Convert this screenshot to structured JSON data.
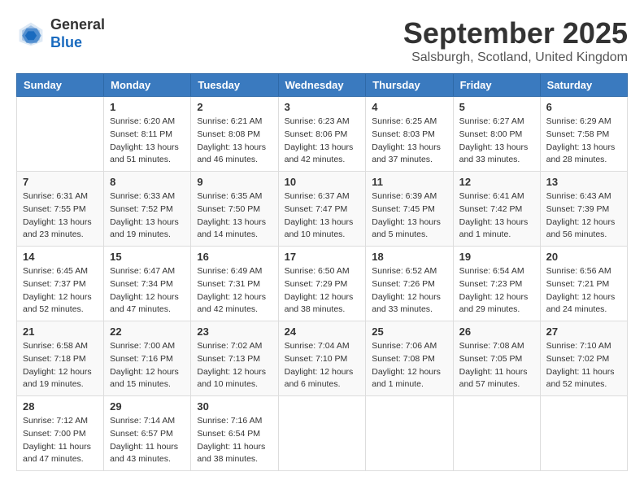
{
  "logo": {
    "general": "General",
    "blue": "Blue"
  },
  "header": {
    "month": "September 2025",
    "location": "Salsburgh, Scotland, United Kingdom"
  },
  "weekdays": [
    "Sunday",
    "Monday",
    "Tuesday",
    "Wednesday",
    "Thursday",
    "Friday",
    "Saturday"
  ],
  "weeks": [
    [
      {
        "day": "",
        "sunrise": "",
        "sunset": "",
        "daylight": ""
      },
      {
        "day": "1",
        "sunrise": "Sunrise: 6:20 AM",
        "sunset": "Sunset: 8:11 PM",
        "daylight": "Daylight: 13 hours and 51 minutes."
      },
      {
        "day": "2",
        "sunrise": "Sunrise: 6:21 AM",
        "sunset": "Sunset: 8:08 PM",
        "daylight": "Daylight: 13 hours and 46 minutes."
      },
      {
        "day": "3",
        "sunrise": "Sunrise: 6:23 AM",
        "sunset": "Sunset: 8:06 PM",
        "daylight": "Daylight: 13 hours and 42 minutes."
      },
      {
        "day": "4",
        "sunrise": "Sunrise: 6:25 AM",
        "sunset": "Sunset: 8:03 PM",
        "daylight": "Daylight: 13 hours and 37 minutes."
      },
      {
        "day": "5",
        "sunrise": "Sunrise: 6:27 AM",
        "sunset": "Sunset: 8:00 PM",
        "daylight": "Daylight: 13 hours and 33 minutes."
      },
      {
        "day": "6",
        "sunrise": "Sunrise: 6:29 AM",
        "sunset": "Sunset: 7:58 PM",
        "daylight": "Daylight: 13 hours and 28 minutes."
      }
    ],
    [
      {
        "day": "7",
        "sunrise": "Sunrise: 6:31 AM",
        "sunset": "Sunset: 7:55 PM",
        "daylight": "Daylight: 13 hours and 23 minutes."
      },
      {
        "day": "8",
        "sunrise": "Sunrise: 6:33 AM",
        "sunset": "Sunset: 7:52 PM",
        "daylight": "Daylight: 13 hours and 19 minutes."
      },
      {
        "day": "9",
        "sunrise": "Sunrise: 6:35 AM",
        "sunset": "Sunset: 7:50 PM",
        "daylight": "Daylight: 13 hours and 14 minutes."
      },
      {
        "day": "10",
        "sunrise": "Sunrise: 6:37 AM",
        "sunset": "Sunset: 7:47 PM",
        "daylight": "Daylight: 13 hours and 10 minutes."
      },
      {
        "day": "11",
        "sunrise": "Sunrise: 6:39 AM",
        "sunset": "Sunset: 7:45 PM",
        "daylight": "Daylight: 13 hours and 5 minutes."
      },
      {
        "day": "12",
        "sunrise": "Sunrise: 6:41 AM",
        "sunset": "Sunset: 7:42 PM",
        "daylight": "Daylight: 13 hours and 1 minute."
      },
      {
        "day": "13",
        "sunrise": "Sunrise: 6:43 AM",
        "sunset": "Sunset: 7:39 PM",
        "daylight": "Daylight: 12 hours and 56 minutes."
      }
    ],
    [
      {
        "day": "14",
        "sunrise": "Sunrise: 6:45 AM",
        "sunset": "Sunset: 7:37 PM",
        "daylight": "Daylight: 12 hours and 52 minutes."
      },
      {
        "day": "15",
        "sunrise": "Sunrise: 6:47 AM",
        "sunset": "Sunset: 7:34 PM",
        "daylight": "Daylight: 12 hours and 47 minutes."
      },
      {
        "day": "16",
        "sunrise": "Sunrise: 6:49 AM",
        "sunset": "Sunset: 7:31 PM",
        "daylight": "Daylight: 12 hours and 42 minutes."
      },
      {
        "day": "17",
        "sunrise": "Sunrise: 6:50 AM",
        "sunset": "Sunset: 7:29 PM",
        "daylight": "Daylight: 12 hours and 38 minutes."
      },
      {
        "day": "18",
        "sunrise": "Sunrise: 6:52 AM",
        "sunset": "Sunset: 7:26 PM",
        "daylight": "Daylight: 12 hours and 33 minutes."
      },
      {
        "day": "19",
        "sunrise": "Sunrise: 6:54 AM",
        "sunset": "Sunset: 7:23 PM",
        "daylight": "Daylight: 12 hours and 29 minutes."
      },
      {
        "day": "20",
        "sunrise": "Sunrise: 6:56 AM",
        "sunset": "Sunset: 7:21 PM",
        "daylight": "Daylight: 12 hours and 24 minutes."
      }
    ],
    [
      {
        "day": "21",
        "sunrise": "Sunrise: 6:58 AM",
        "sunset": "Sunset: 7:18 PM",
        "daylight": "Daylight: 12 hours and 19 minutes."
      },
      {
        "day": "22",
        "sunrise": "Sunrise: 7:00 AM",
        "sunset": "Sunset: 7:16 PM",
        "daylight": "Daylight: 12 hours and 15 minutes."
      },
      {
        "day": "23",
        "sunrise": "Sunrise: 7:02 AM",
        "sunset": "Sunset: 7:13 PM",
        "daylight": "Daylight: 12 hours and 10 minutes."
      },
      {
        "day": "24",
        "sunrise": "Sunrise: 7:04 AM",
        "sunset": "Sunset: 7:10 PM",
        "daylight": "Daylight: 12 hours and 6 minutes."
      },
      {
        "day": "25",
        "sunrise": "Sunrise: 7:06 AM",
        "sunset": "Sunset: 7:08 PM",
        "daylight": "Daylight: 12 hours and 1 minute."
      },
      {
        "day": "26",
        "sunrise": "Sunrise: 7:08 AM",
        "sunset": "Sunset: 7:05 PM",
        "daylight": "Daylight: 11 hours and 57 minutes."
      },
      {
        "day": "27",
        "sunrise": "Sunrise: 7:10 AM",
        "sunset": "Sunset: 7:02 PM",
        "daylight": "Daylight: 11 hours and 52 minutes."
      }
    ],
    [
      {
        "day": "28",
        "sunrise": "Sunrise: 7:12 AM",
        "sunset": "Sunset: 7:00 PM",
        "daylight": "Daylight: 11 hours and 47 minutes."
      },
      {
        "day": "29",
        "sunrise": "Sunrise: 7:14 AM",
        "sunset": "Sunset: 6:57 PM",
        "daylight": "Daylight: 11 hours and 43 minutes."
      },
      {
        "day": "30",
        "sunrise": "Sunrise: 7:16 AM",
        "sunset": "Sunset: 6:54 PM",
        "daylight": "Daylight: 11 hours and 38 minutes."
      },
      {
        "day": "",
        "sunrise": "",
        "sunset": "",
        "daylight": ""
      },
      {
        "day": "",
        "sunrise": "",
        "sunset": "",
        "daylight": ""
      },
      {
        "day": "",
        "sunrise": "",
        "sunset": "",
        "daylight": ""
      },
      {
        "day": "",
        "sunrise": "",
        "sunset": "",
        "daylight": ""
      }
    ]
  ]
}
